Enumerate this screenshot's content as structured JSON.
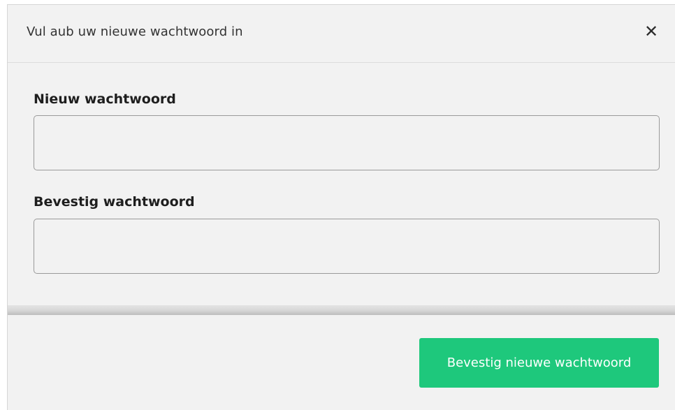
{
  "dialog": {
    "title": "Vul aub uw nieuwe wachtwoord in",
    "close_icon": "close-icon",
    "close_glyph": "✕"
  },
  "form": {
    "new_password": {
      "label": "Nieuw wachtwoord",
      "value": "",
      "placeholder": ""
    },
    "confirm_password": {
      "label": "Bevestig wachtwoord",
      "value": "",
      "placeholder": ""
    }
  },
  "footer": {
    "submit_label": "Bevestig nieuwe wachtwoord"
  },
  "colors": {
    "background": "#f2f2f2",
    "primary_button": "#1ec87c",
    "button_text": "#ffffff"
  }
}
